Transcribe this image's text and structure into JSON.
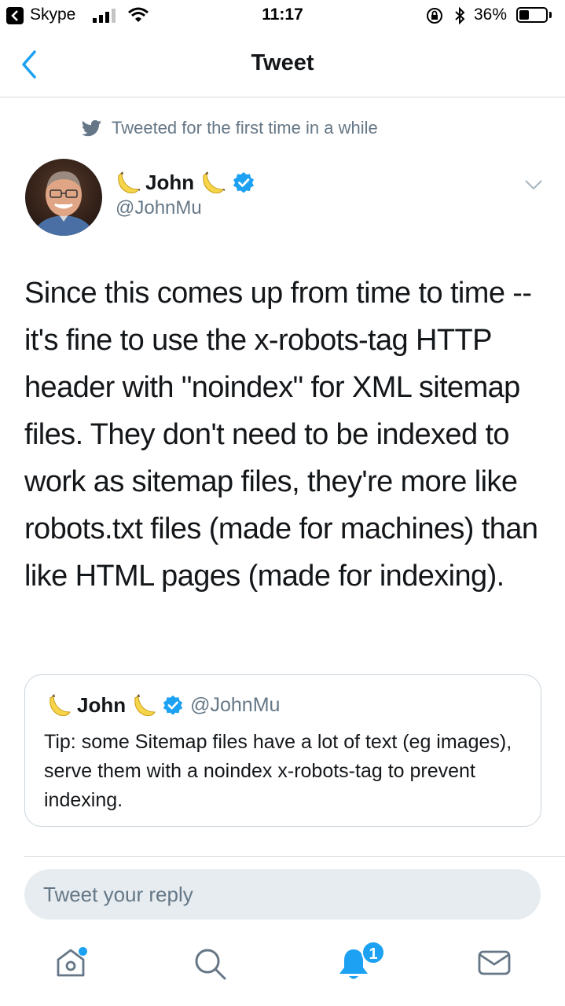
{
  "status_bar": {
    "back_app": "Skype",
    "time": "11:17",
    "battery": "36%",
    "battery_level": 0.36
  },
  "nav": {
    "title": "Tweet"
  },
  "context": {
    "text": "Tweeted for the first time in a while"
  },
  "author": {
    "name": "John",
    "handle": "@JohnMu",
    "name_emoji": "banana-icon",
    "verified_icon": "verified-badge-icon"
  },
  "tweet": {
    "text": "Since this comes up from time to time -- it's fine to use the x-robots-tag HTTP header with \"noindex\" for XML sitemap files. They don't need to be indexed to work as sitemap files, they're more like robots.txt files (made for machines) than like HTML pages (made for indexing)."
  },
  "quote": {
    "name": "John",
    "handle": "@JohnMu",
    "text": "Tip: some Sitemap files have a lot of text (eg images), serve them with a noindex x-robots-tag to prevent indexing."
  },
  "reply": {
    "placeholder": "Tweet your reply"
  },
  "tabs": {
    "items": [
      "home-icon",
      "search-icon",
      "notifications-icon",
      "messages-icon"
    ],
    "notification_count": "1"
  },
  "colors": {
    "accent": "#1da1f2",
    "secondary_text": "#657786"
  }
}
